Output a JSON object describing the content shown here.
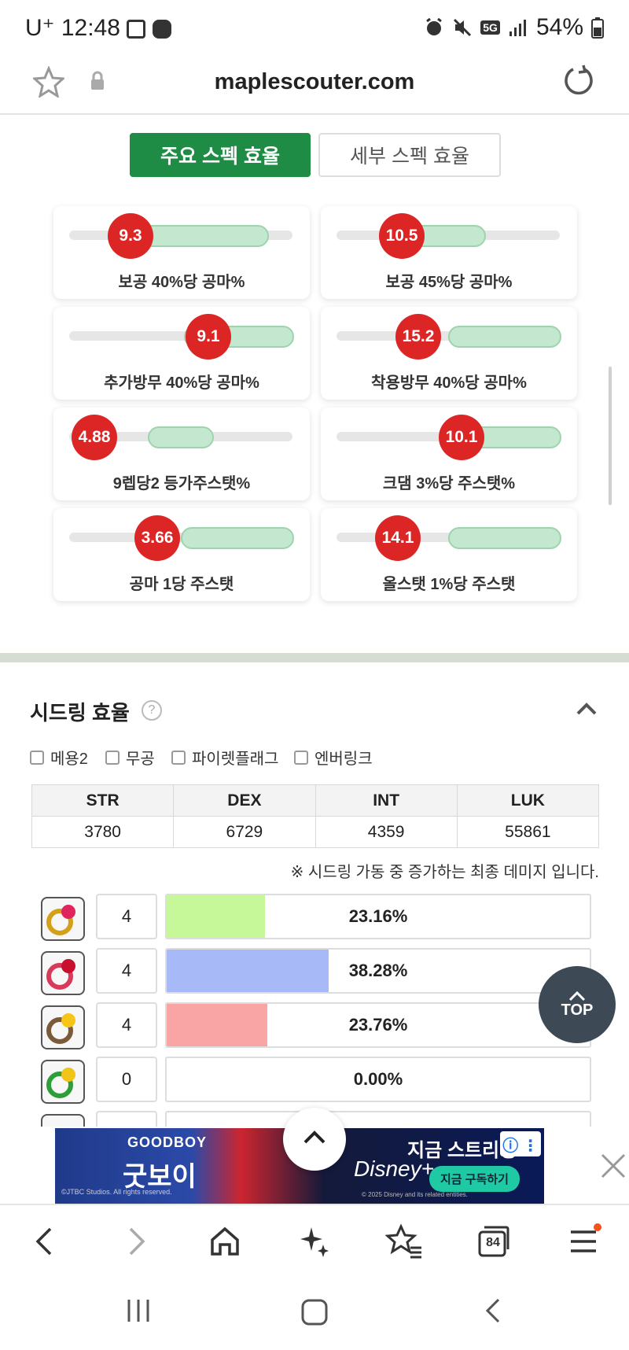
{
  "status_bar": {
    "carrier": "U⁺",
    "time": "12:48",
    "network": "5G",
    "battery": "54%"
  },
  "address_bar": {
    "url": "maplescouter.com"
  },
  "tabs": {
    "main": "주요 스펙 효율",
    "detail": "세부 스펙 효율"
  },
  "cards": [
    {
      "value": "9.3",
      "label": "보공 40%당 공마%"
    },
    {
      "value": "10.5",
      "label": "보공 45%당 공마%"
    },
    {
      "value": "9.1",
      "label": "추가방무 40%당 공마%"
    },
    {
      "value": "15.2",
      "label": "착용방무 40%당 공마%"
    },
    {
      "value": "4.88",
      "label": "9렙당2 등가주스탯%"
    },
    {
      "value": "10.1",
      "label": "크댐 3%당 주스탯%"
    },
    {
      "value": "3.66",
      "label": "공마 1당 주스탯"
    },
    {
      "value": "14.1",
      "label": "올스탯 1%당 주스탯"
    }
  ],
  "seeding": {
    "title": "시드링 효율",
    "help_icon": "?",
    "checkboxes": [
      "메용2",
      "무공",
      "파이렛플래그",
      "엔버링크"
    ],
    "stats_header": [
      "STR",
      "DEX",
      "INT",
      "LUK"
    ],
    "stats_values": [
      "3780",
      "6729",
      "4359",
      "55861"
    ],
    "note": "※ 시드링 가동 중 증가하는 최종 데미지 입니다.",
    "rows": [
      {
        "icon": "ring-icon-red-gold",
        "level": "4",
        "percent_text": "23.16%",
        "percent": 23.16,
        "color": "#c6f89a"
      },
      {
        "icon": "ring-icon-red-silver",
        "level": "4",
        "percent_text": "38.28%",
        "percent": 38.28,
        "color": "#a7b9f6"
      },
      {
        "icon": "ring-icon-gold-gem",
        "level": "4",
        "percent_text": "23.76%",
        "percent": 23.76,
        "color": "#f9a5a5"
      },
      {
        "icon": "ring-icon-green-gold",
        "level": "0",
        "percent_text": "0.00%",
        "percent": 0,
        "color": "#cccccc"
      }
    ]
  },
  "top_button": {
    "label": "TOP"
  },
  "ad": {
    "title_en": "GOODBOY",
    "title_ko": "굿보이",
    "brand": "Disney+",
    "stream": "지금 스트리밍",
    "cta": "지금 구독하기",
    "copyright": "©JTBC Studios. All rights reserved.",
    "copyright2": "© 2025 Disney and its related entities."
  },
  "bottom_nav": {
    "tabs_count": "84"
  }
}
